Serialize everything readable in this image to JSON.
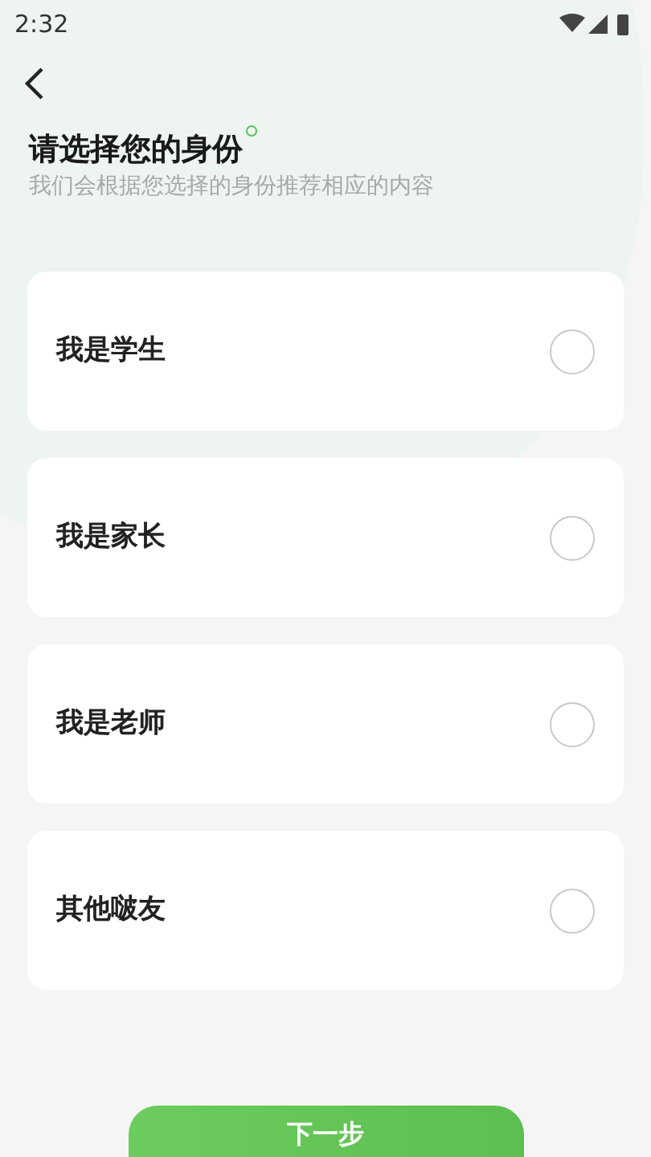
{
  "status_bar": {
    "time": "2:32"
  },
  "title": "请选择您的身份",
  "subtitle": "我们会根据您选择的身份推荐相应的内容",
  "options": [
    {
      "label": "我是学生",
      "selected": false
    },
    {
      "label": "我是家长",
      "selected": false
    },
    {
      "label": "我是老师",
      "selected": false
    },
    {
      "label": "其他啵友",
      "selected": false
    }
  ],
  "next_button": "下一步"
}
